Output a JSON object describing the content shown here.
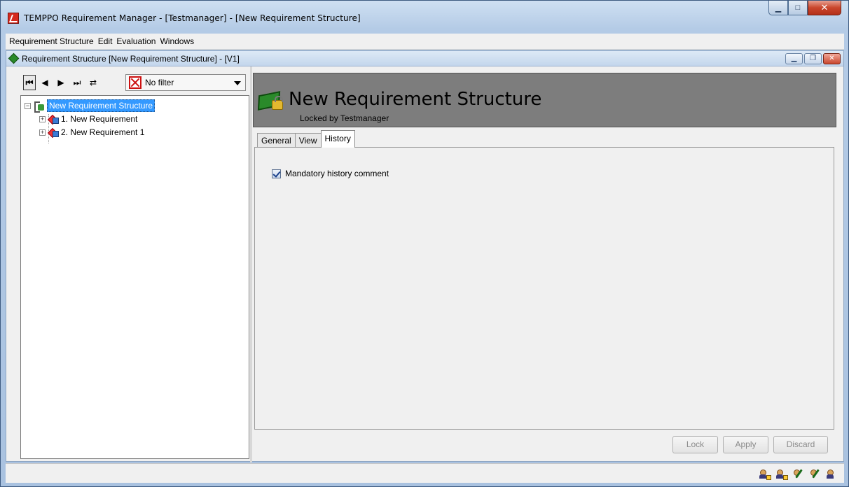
{
  "window": {
    "title": "TEMPPO Requirement Manager - [Testmanager] - [New Requirement Structure]",
    "buttons": [
      "minimize",
      "maximize",
      "close"
    ]
  },
  "menubar": {
    "items": [
      "Requirement Structure",
      "Edit",
      "Evaluation",
      "Windows"
    ]
  },
  "child_window": {
    "title": "Requirement Structure [New Requirement Structure] - [V1]"
  },
  "toolbar": {
    "filter_value": "No filter"
  },
  "tree": {
    "root": "New Requirement Structure",
    "items": [
      "1. New Requirement",
      "2. New Requirement 1"
    ]
  },
  "detail": {
    "title": "New Requirement Structure",
    "subtitle": "Locked by Testmanager",
    "tabs": [
      "General",
      "View",
      "History"
    ],
    "active_tab": "History",
    "checkbox": {
      "label": "Mandatory history comment",
      "checked": true
    },
    "buttons": {
      "lock": "Lock",
      "apply": "Apply",
      "discard": "Discard"
    }
  },
  "colors": {
    "selection": "#3399ff",
    "header_band": "#7d7d7d"
  }
}
